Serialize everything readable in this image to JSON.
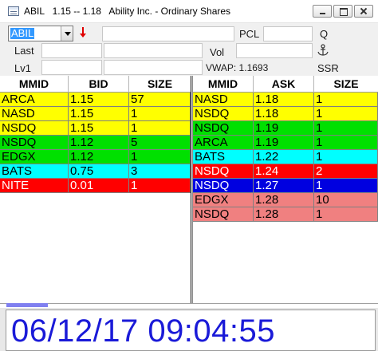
{
  "window": {
    "ticker": "ABIL",
    "range": "1.15 -- 1.18",
    "name": "Ability Inc. - Ordinary Shares"
  },
  "form": {
    "symbol_value": "ABIL",
    "pcl_label": "PCL",
    "q_label": "Q",
    "last_label": "Last",
    "vol_label": "Vol",
    "lv1_label": "Lv1",
    "vwap_text": "VWAP: 1.1693",
    "ssr_label": "SSR"
  },
  "bid_book": {
    "headers": [
      "MMID",
      "BID",
      "SIZE"
    ],
    "rows": [
      {
        "mmid": "ARCA",
        "price": "1.15",
        "size": "57",
        "bg": "#ffff00",
        "fg": "#000000"
      },
      {
        "mmid": "NASD",
        "price": "1.15",
        "size": "1",
        "bg": "#ffff00",
        "fg": "#000000"
      },
      {
        "mmid": "NSDQ",
        "price": "1.15",
        "size": "1",
        "bg": "#ffff00",
        "fg": "#000000"
      },
      {
        "mmid": "NSDQ",
        "price": "1.12",
        "size": "5",
        "bg": "#00e000",
        "fg": "#000000"
      },
      {
        "mmid": "EDGX",
        "price": "1.12",
        "size": "1",
        "bg": "#00e000",
        "fg": "#000000"
      },
      {
        "mmid": "BATS",
        "price": "0.75",
        "size": "3",
        "bg": "#00ffff",
        "fg": "#000000"
      },
      {
        "mmid": "NITE",
        "price": "0.01",
        "size": "1",
        "bg": "#ff0000",
        "fg": "#ffffff"
      }
    ]
  },
  "ask_book": {
    "headers": [
      "MMID",
      "ASK",
      "SIZE"
    ],
    "rows": [
      {
        "mmid": "NASD",
        "price": "1.18",
        "size": "1",
        "bg": "#ffff00",
        "fg": "#000000"
      },
      {
        "mmid": "NSDQ",
        "price": "1.18",
        "size": "1",
        "bg": "#ffff00",
        "fg": "#000000"
      },
      {
        "mmid": "NSDQ",
        "price": "1.19",
        "size": "1",
        "bg": "#00e000",
        "fg": "#000000"
      },
      {
        "mmid": "ARCA",
        "price": "1.19",
        "size": "1",
        "bg": "#00e000",
        "fg": "#000000"
      },
      {
        "mmid": "BATS",
        "price": "1.22",
        "size": "1",
        "bg": "#00ffff",
        "fg": "#000000"
      },
      {
        "mmid": "NSDQ",
        "price": "1.24",
        "size": "2",
        "bg": "#ff0000",
        "fg": "#ffffff"
      },
      {
        "mmid": "NSDQ",
        "price": "1.27",
        "size": "1",
        "bg": "#0000e0",
        "fg": "#ffffff"
      },
      {
        "mmid": "EDGX",
        "price": "1.28",
        "size": "10",
        "bg": "#f08080",
        "fg": "#000000"
      },
      {
        "mmid": "NSDQ",
        "price": "1.28",
        "size": "1",
        "bg": "#f08080",
        "fg": "#000000"
      }
    ]
  },
  "clock": {
    "datetime": "06/12/17 09:04:55",
    "color": "#1a1ad8"
  }
}
